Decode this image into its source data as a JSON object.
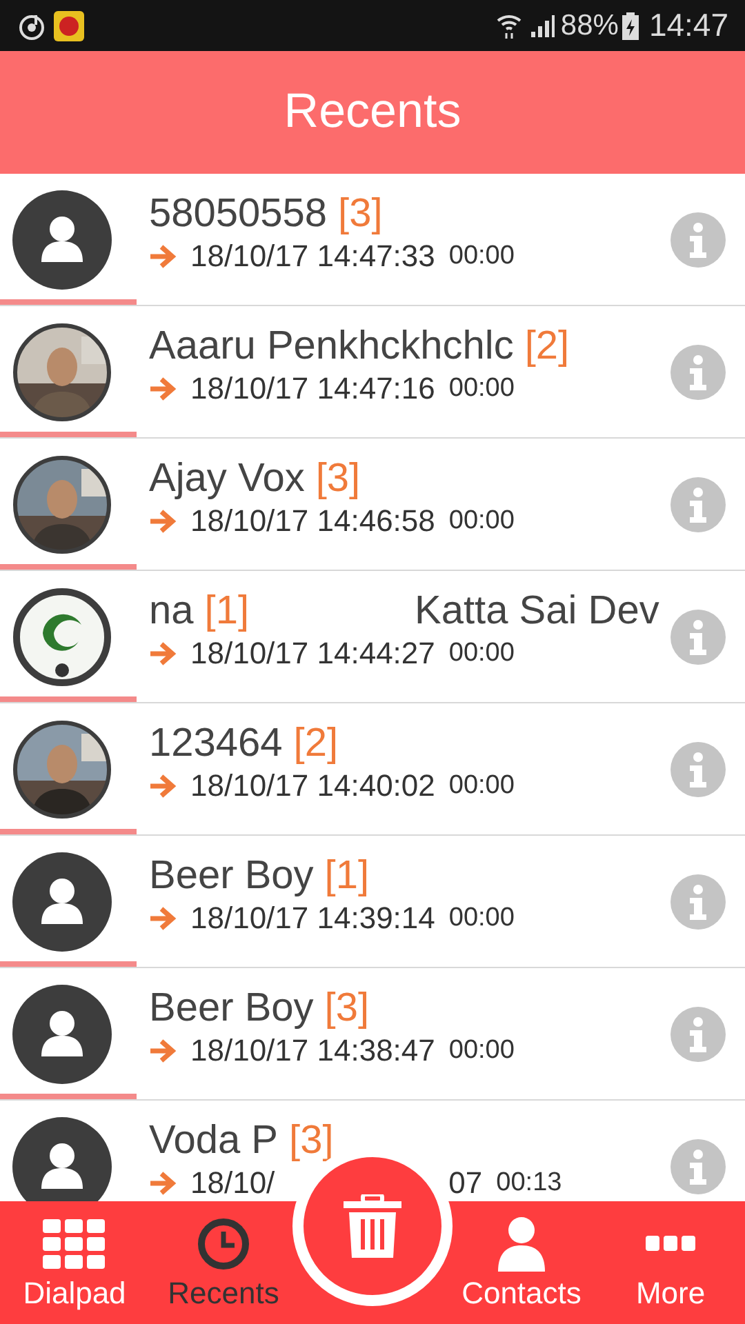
{
  "status_bar": {
    "battery": "88%",
    "time": "14:47"
  },
  "header": {
    "title": "Recents"
  },
  "calls": [
    {
      "kind": "placeholder",
      "name": "58050558",
      "count": "[3]",
      "datetime": "18/10/17 14:47:33",
      "duration": "00:00"
    },
    {
      "kind": "picture",
      "name": "Aaaru Penkhckhchlc",
      "count": "[2]",
      "datetime": "18/10/17 14:47:16",
      "duration": "00:00"
    },
    {
      "kind": "picture",
      "name": "Ajay Vox",
      "count": "[3]",
      "datetime": "18/10/17 14:46:58",
      "duration": "00:00"
    },
    {
      "kind": "logo",
      "name": "na",
      "count": "[1]",
      "name_2": "Katta Sai Dev",
      "datetime": "18/10/17 14:44:27",
      "duration": "00:00"
    },
    {
      "kind": "picture",
      "name": "123464",
      "count": "[2]",
      "datetime": "18/10/17 14:40:02",
      "duration": "00:00"
    },
    {
      "kind": "placeholder",
      "name": "Beer Boy",
      "count": "[1]",
      "datetime": "18/10/17 14:39:14",
      "duration": "00:00"
    },
    {
      "kind": "placeholder",
      "name": "Beer Boy",
      "count": "[3]",
      "datetime": "18/10/17 14:38:47",
      "duration": "00:00"
    },
    {
      "kind": "placeholder",
      "name": "Voda P",
      "count": "[3]",
      "datetime": "18/10/",
      "datetime_end": "07",
      "duration": "00:13"
    }
  ],
  "nav": [
    {
      "label": "Dialpad",
      "selected": false
    },
    {
      "label": "Recents",
      "selected": true
    },
    {
      "label": "Contacts",
      "selected": false
    },
    {
      "label": "More",
      "selected": false
    }
  ]
}
